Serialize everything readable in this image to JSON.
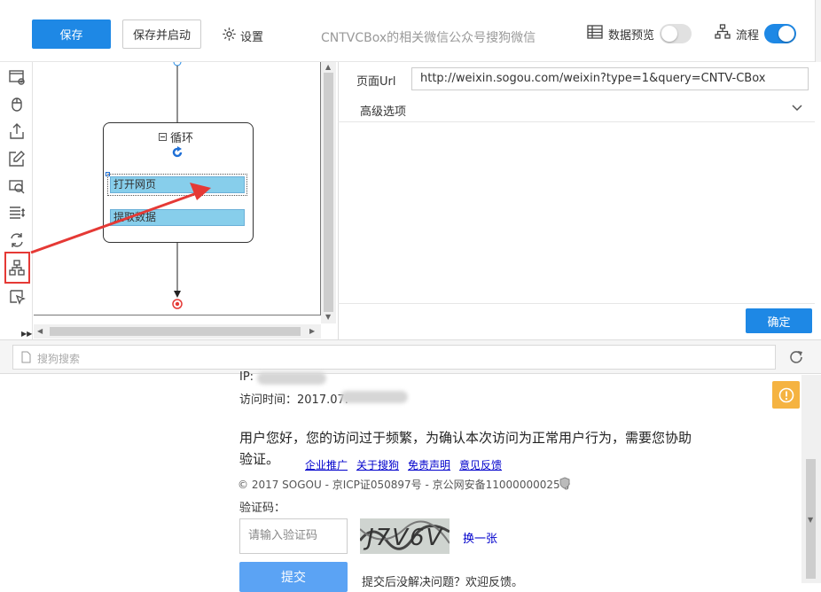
{
  "toolbar": {
    "save_label": "保存",
    "save_start_label": "保存并启动",
    "settings_label": "设置",
    "task_title": "CNTVCBox的相关微信公众号搜狗微信",
    "preview_label": "数据预览",
    "preview_enabled": false,
    "flow_label": "流程",
    "flow_enabled": true
  },
  "rail": {
    "items": [
      {
        "icon": "open-page-icon"
      },
      {
        "icon": "click-icon"
      },
      {
        "icon": "extract-icon"
      },
      {
        "icon": "input-text-icon"
      },
      {
        "icon": "captcha-icon"
      },
      {
        "icon": "switch-dropdown-icon"
      },
      {
        "icon": "loop-icon"
      },
      {
        "icon": "flow-chart-icon",
        "highlighted": true
      },
      {
        "icon": "mouse-hover-icon"
      }
    ]
  },
  "flow": {
    "loop_title": "循环",
    "steps": [
      "打开网页",
      "提取数据"
    ]
  },
  "props": {
    "url_label": "页面Url",
    "url_value": "http://weixin.sogou.com/weixin?type=1&query=CNTV-CBox",
    "advanced_label": "高级选项",
    "ok_label": "确定"
  },
  "browser": {
    "address_placeholder": "搜狗搜索"
  },
  "webpage": {
    "ip_label": "IP:",
    "visit_time_label": "访问时间：2017.07.",
    "message_line1": "用户您好，您的访问过于频繁，为确认本次访问为正常用户行为，需要您协助",
    "message_line2": "验证。",
    "links": [
      "企业推广",
      "关于搜狗",
      "免责声明",
      "意见反馈"
    ],
    "copyright": "© 2017 SOGOU - 京ICP证050897号 - 京公网安备11000000025号",
    "captcha_label": "验证码：",
    "captcha_placeholder": "请输入验证码",
    "captcha_text": "J7V6V",
    "refresh_label": "换一张",
    "submit_label": "提交",
    "feedback_text": "提交后没解决问题？欢迎反馈。"
  },
  "colors": {
    "primary": "#1e88e5",
    "highlight": "#e53935",
    "step_fill": "#87ceeb",
    "warning": "#f5b341"
  }
}
